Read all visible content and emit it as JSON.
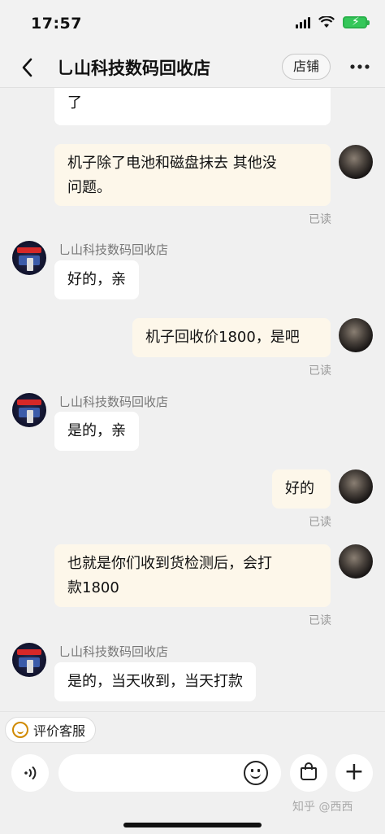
{
  "status_bar": {
    "time": "17:57"
  },
  "header": {
    "back_icon": "chevron-left-icon",
    "title": "乚山科技数码回收店",
    "shop_button": "店铺",
    "more_icon": "more-icon"
  },
  "messages": [
    {
      "side": "theirs",
      "text": "了"
    },
    {
      "side": "mine",
      "text_line1": "机子除了电池和磁盘抹去 其他没",
      "text_line2": "问题。",
      "status": "已读"
    },
    {
      "side": "theirs",
      "sender": "乚山科技数码回收店",
      "text": "好的，亲"
    },
    {
      "side": "mine",
      "text": "机子回收价1800，是吧",
      "status": "已读"
    },
    {
      "side": "theirs",
      "sender": "乚山科技数码回收店",
      "text": "是的，亲"
    },
    {
      "side": "mine",
      "text": "好的",
      "status": "已读"
    },
    {
      "side": "mine",
      "text_line1": "也就是你们收到货检测后，会打",
      "text_line2": "款1800",
      "status": "已读"
    },
    {
      "side": "theirs",
      "sender": "乚山科技数码回收店",
      "text": "是的，当天收到，当天打款"
    }
  ],
  "bottom": {
    "rate_chip": "评价客服",
    "voice_icon": "voice-icon",
    "emoji_icon": "emoji-icon",
    "shop_bag_icon": "shopping-bag-icon",
    "plus_icon": "plus-icon",
    "watermark": "知乎 @西西"
  }
}
